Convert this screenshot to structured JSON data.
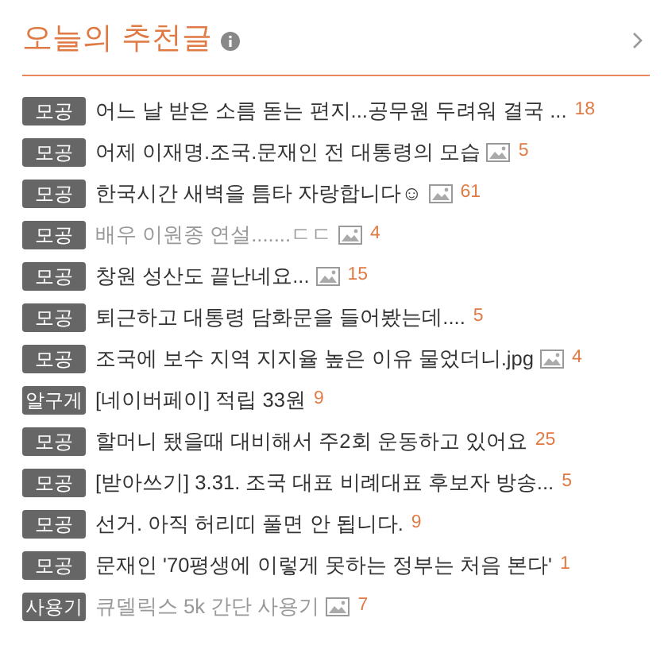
{
  "header": {
    "title": "오늘의 추천글"
  },
  "posts": [
    {
      "category": "모공",
      "title": "어느 날 받은 소름 돋는 편지...공무원 두려워 결국 ...",
      "has_image": false,
      "visited": false,
      "comments": "18"
    },
    {
      "category": "모공",
      "title": "어제 이재명.조국.문재인 전 대통령의 모습",
      "has_image": true,
      "visited": false,
      "comments": "5"
    },
    {
      "category": "모공",
      "title": "한국시간 새벽을 틈타 자랑합니다☺",
      "has_image": true,
      "visited": false,
      "comments": "61"
    },
    {
      "category": "모공",
      "title": "배우 이원종 연설.......ㄷㄷ",
      "has_image": true,
      "visited": true,
      "comments": "4"
    },
    {
      "category": "모공",
      "title": "창원 성산도 끝난네요...",
      "has_image": true,
      "visited": false,
      "comments": "15"
    },
    {
      "category": "모공",
      "title": "퇴근하고 대통령 담화문을 들어봤는데....",
      "has_image": false,
      "visited": false,
      "comments": "5"
    },
    {
      "category": "모공",
      "title": "조국에 보수 지역 지지율 높은 이유 물었더니.jpg",
      "has_image": true,
      "visited": false,
      "comments": "4"
    },
    {
      "category": "알구게",
      "title": "[네이버페이] 적립 33원",
      "has_image": false,
      "visited": false,
      "comments": "9"
    },
    {
      "category": "모공",
      "title": "할머니 됐을때 대비해서 주2회 운동하고 있어요",
      "has_image": false,
      "visited": false,
      "comments": "25"
    },
    {
      "category": "모공",
      "title": "[받아쓰기] 3.31. 조국 대표 비례대표 후보자 방송...",
      "has_image": false,
      "visited": false,
      "comments": "5"
    },
    {
      "category": "모공",
      "title": "선거. 아직 허리띠 풀면 안 됩니다.",
      "has_image": false,
      "visited": false,
      "comments": "9"
    },
    {
      "category": "모공",
      "title": "문재인 '70평생에 이렇게 못하는 정부는 처음 본다'",
      "has_image": false,
      "visited": false,
      "comments": "1"
    },
    {
      "category": "사용기",
      "title": "큐델릭스 5k 간단 사용기",
      "has_image": true,
      "visited": true,
      "comments": "7"
    }
  ]
}
